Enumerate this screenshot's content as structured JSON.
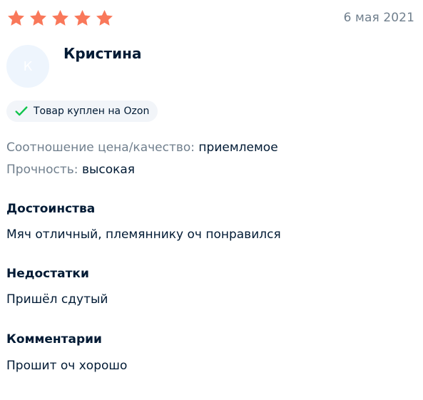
{
  "review": {
    "rating": 5,
    "max_rating": 5,
    "date": "6 мая 2021",
    "author": {
      "name": "Кристина",
      "initial": "К"
    },
    "badge": {
      "text": "Товар куплен на Ozon",
      "icon": "check-icon"
    },
    "attributes": [
      {
        "key": "Соотношение цена/качество:",
        "value": "приемлемое"
      },
      {
        "key": "Прочность:",
        "value": "высокая"
      }
    ],
    "sections": [
      {
        "title": "Достоинства",
        "text": "Мяч отличный, племяннику оч понравился"
      },
      {
        "title": "Недостатки",
        "text": "Пришёл сдутый"
      },
      {
        "title": "Комментарии",
        "text": "Прошит оч хорошо"
      }
    ]
  },
  "colors": {
    "star": "#f9785a",
    "check": "#10c44c",
    "text_primary": "#001a34",
    "text_secondary": "#707f8d",
    "avatar_bg": "#eef5fd",
    "badge_bg": "#f2f5f9"
  }
}
